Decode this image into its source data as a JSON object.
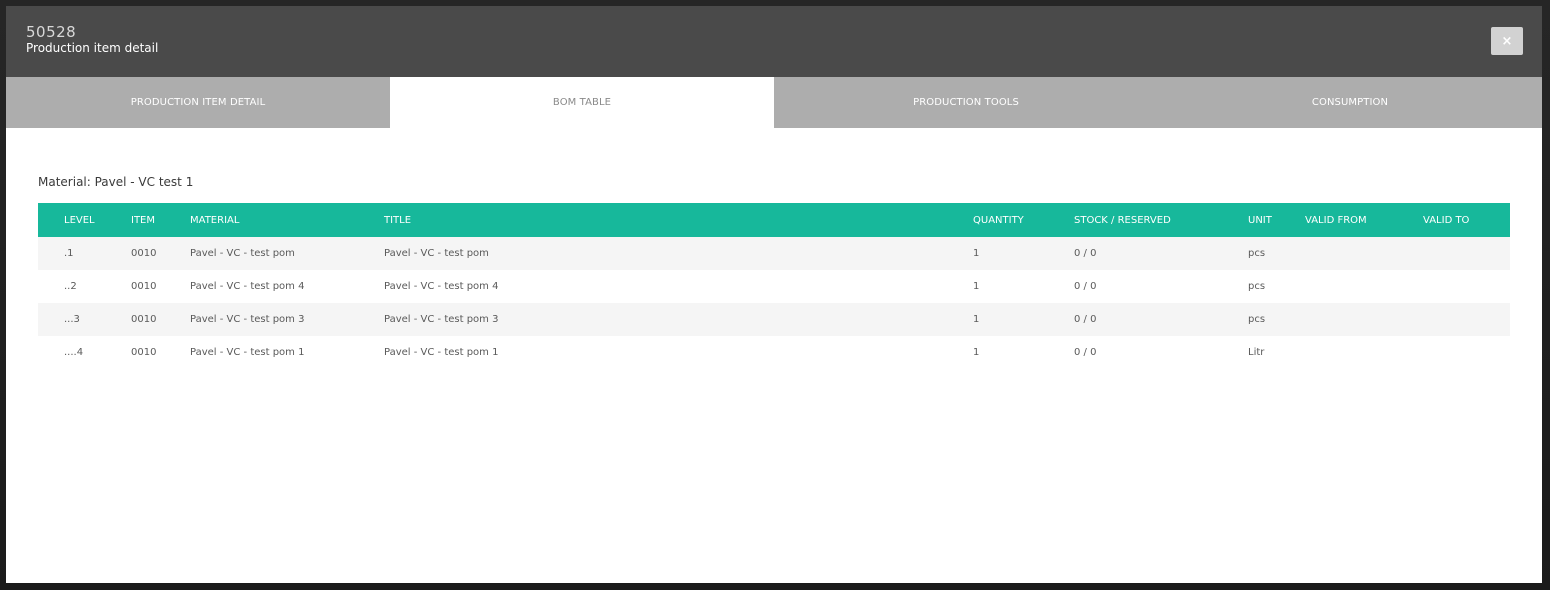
{
  "modal": {
    "id": "50528",
    "title": "Production item detail",
    "close_label": "×"
  },
  "tabs": [
    {
      "label": "PRODUCTION ITEM DETAIL",
      "active": false
    },
    {
      "label": "BOM TABLE",
      "active": true
    },
    {
      "label": "PRODUCTION TOOLS",
      "active": false
    },
    {
      "label": "CONSUMPTION",
      "active": false
    }
  ],
  "material_label": "Material: Pavel - VC test 1",
  "table": {
    "columns": [
      "LEVEL",
      "ITEM",
      "MATERIAL",
      "TITLE",
      "QUANTITY",
      "STOCK / RESERVED",
      "UNIT",
      "VALID FROM",
      "VALID TO"
    ],
    "rows": [
      {
        "level": ".1",
        "item": "0010",
        "material": "Pavel - VC - test pom",
        "title": "Pavel - VC - test pom",
        "quantity": "1",
        "stock": "0 / 0",
        "unit": "pcs",
        "valid_from": "",
        "valid_to": ""
      },
      {
        "level": "..2",
        "item": "0010",
        "material": "Pavel - VC - test pom 4",
        "title": "Pavel - VC - test pom 4",
        "quantity": "1",
        "stock": "0 / 0",
        "unit": "pcs",
        "valid_from": "",
        "valid_to": ""
      },
      {
        "level": "...3",
        "item": "0010",
        "material": "Pavel - VC - test pom 3",
        "title": "Pavel - VC - test pom 3",
        "quantity": "1",
        "stock": "0 / 0",
        "unit": "pcs",
        "valid_from": "",
        "valid_to": ""
      },
      {
        "level": "....4",
        "item": "0010",
        "material": "Pavel - VC - test pom 1",
        "title": "Pavel - VC - test pom 1",
        "quantity": "1",
        "stock": "0 / 0",
        "unit": "Litr",
        "valid_from": "",
        "valid_to": ""
      }
    ]
  },
  "colors": {
    "header_bg": "#4a4a4a",
    "tab_inactive": "#adadad",
    "table_header": "#17b89b"
  }
}
